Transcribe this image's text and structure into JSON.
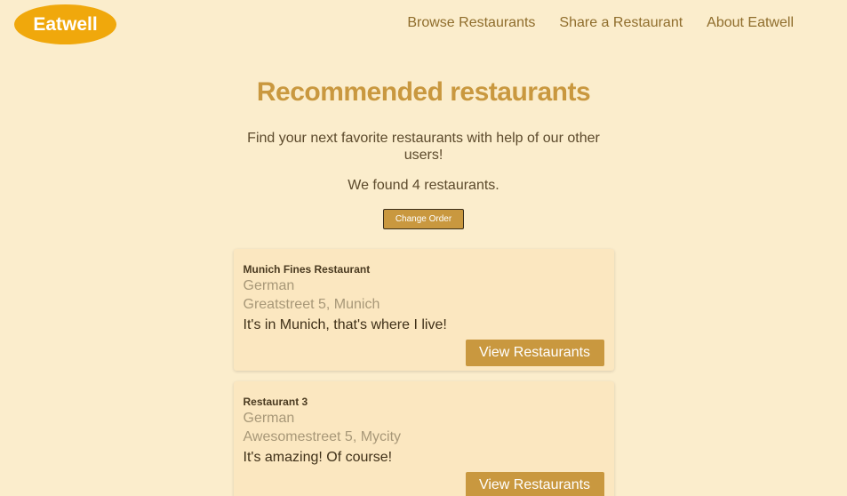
{
  "nav": {
    "logo": "Eatwell",
    "links": [
      "Browse Restaurants",
      "Share a Restaurant",
      "About Eatwell"
    ]
  },
  "main": {
    "title": "Recommended restaurants",
    "subtitle": "Find your next favorite restaurants with help of our other users!",
    "count_text": "We found 4 restaurants.",
    "order_button": "Change Order"
  },
  "restaurants": [
    {
      "name": "Munich Fines Restaurant",
      "cuisine": "German",
      "address": "Greatstreet 5, Munich",
      "comment": "It's in Munich, that's where I live!",
      "button": "View Restaurants"
    },
    {
      "name": "Restaurant 3",
      "cuisine": "German",
      "address": "Awesomestreet 5, Mycity",
      "comment": "It's amazing! Of course!",
      "button": "View Restaurants"
    }
  ],
  "colors": {
    "background": "#fbedcc",
    "logo": "#f0a80c",
    "accent": "#c9983f",
    "card": "#fbe7c0"
  }
}
